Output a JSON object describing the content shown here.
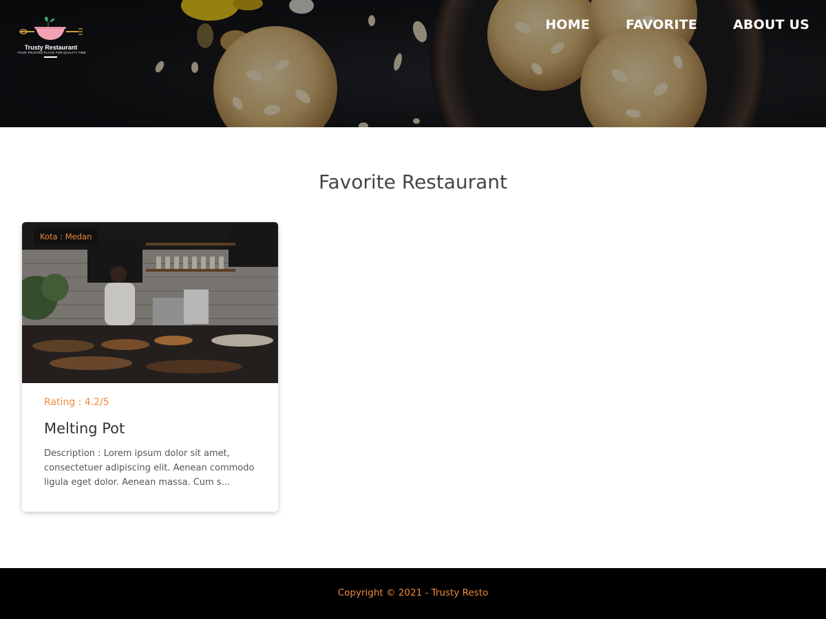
{
  "brand": {
    "name": "Trusty Restaurant",
    "tagline": "YOUR TRUSTED PLACE FOR QUALITY TIME"
  },
  "nav": {
    "items": [
      "HOME",
      "FAVORITE",
      "ABOUT US"
    ]
  },
  "main": {
    "title": "Favorite Restaurant",
    "restaurants": [
      {
        "city_label": "Kota : Medan",
        "rating_label": "Rating : 4.2/5",
        "name": "Melting Pot",
        "description": "Description : Lorem ipsum dolor sit amet, consectetuer adipiscing elit. Aenean commodo ligula eget dolor. Aenean massa. Cum s..."
      }
    ]
  },
  "footer": {
    "copyright": "Copyright © 2021 - Trusty Resto"
  },
  "colors": {
    "accent": "#f08a3c",
    "footer_bg": "#000000",
    "hero_bg": "#15161a"
  }
}
